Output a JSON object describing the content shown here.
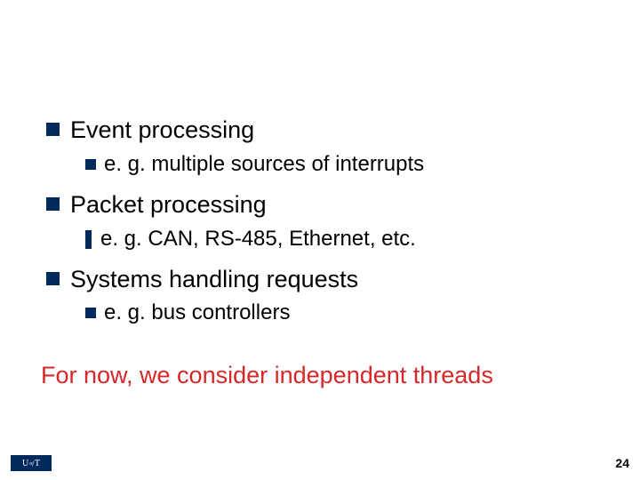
{
  "bullets": [
    {
      "text": "Event processing",
      "sub": {
        "style": "square",
        "text": "e. g. multiple sources of interrupts"
      }
    },
    {
      "text": "Packet processing",
      "sub": {
        "style": "tall",
        "text": "e. g. CAN, RS-485, Ethernet, etc."
      }
    },
    {
      "text": "Systems handling requests",
      "sub": {
        "style": "square",
        "text": "e. g. bus controllers"
      }
    }
  ],
  "closing": "For now, we consider independent threads",
  "logo": {
    "left": "U",
    "of": "of",
    "right": "T"
  },
  "page_number": "24"
}
